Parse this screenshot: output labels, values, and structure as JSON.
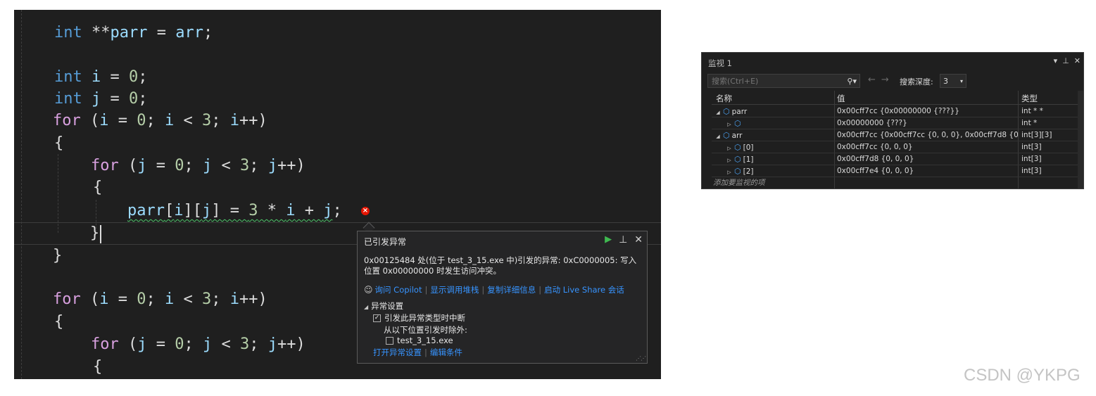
{
  "editor": {
    "lines": [
      {
        "parts": [
          [
            "kw",
            "int"
          ],
          [
            "op",
            " **"
          ],
          [
            "var",
            "parr"
          ],
          [
            "op",
            " = "
          ],
          [
            "var",
            "arr"
          ],
          [
            "op",
            ";"
          ]
        ]
      },
      {
        "parts": [
          [
            "kw",
            "int"
          ],
          [
            "op",
            " "
          ],
          [
            "var",
            "i"
          ],
          [
            "op",
            " = "
          ],
          [
            "num",
            "0"
          ],
          [
            "op",
            ";"
          ]
        ]
      },
      {
        "parts": [
          [
            "kw",
            "int"
          ],
          [
            "op",
            " "
          ],
          [
            "var",
            "j"
          ],
          [
            "op",
            " = "
          ],
          [
            "num",
            "0"
          ],
          [
            "op",
            ";"
          ]
        ]
      },
      {
        "parts": [
          [
            "kw2",
            "for"
          ],
          [
            "op",
            " ("
          ],
          [
            "var",
            "i"
          ],
          [
            "op",
            " = "
          ],
          [
            "num",
            "0"
          ],
          [
            "op",
            "; "
          ],
          [
            "var",
            "i"
          ],
          [
            "op",
            " < "
          ],
          [
            "num",
            "3"
          ],
          [
            "op",
            "; "
          ],
          [
            "var",
            "i"
          ],
          [
            "op",
            "++)"
          ]
        ]
      },
      {
        "parts": [
          [
            "op",
            "{"
          ]
        ]
      },
      {
        "parts": [
          [
            "kw2",
            "for"
          ],
          [
            "op",
            " ("
          ],
          [
            "var",
            "j"
          ],
          [
            "op",
            " = "
          ],
          [
            "num",
            "0"
          ],
          [
            "op",
            "; "
          ],
          [
            "var",
            "j"
          ],
          [
            "op",
            " < "
          ],
          [
            "num",
            "3"
          ],
          [
            "op",
            "; "
          ],
          [
            "var",
            "j"
          ],
          [
            "op",
            "++)"
          ]
        ]
      },
      {
        "parts": [
          [
            "op",
            "{"
          ]
        ]
      },
      {
        "parts": [
          [
            "var squig",
            "parr"
          ],
          [
            "op squig",
            "["
          ],
          [
            "var squig",
            "i"
          ],
          [
            "op squig",
            "]["
          ],
          [
            "var squig",
            "j"
          ],
          [
            "op squig",
            "] = "
          ],
          [
            "num squig",
            "3"
          ],
          [
            "op squig",
            " * "
          ],
          [
            "var squig",
            "i"
          ],
          [
            "op squig",
            " + "
          ],
          [
            "var squig",
            "j"
          ],
          [
            "op",
            ";"
          ]
        ]
      },
      {
        "parts": [
          [
            "op",
            "}"
          ]
        ]
      },
      {
        "parts": [
          [
            "op",
            "}"
          ]
        ]
      },
      {
        "parts": [
          [
            "kw2",
            "for"
          ],
          [
            "op",
            " ("
          ],
          [
            "var",
            "i"
          ],
          [
            "op",
            " = "
          ],
          [
            "num",
            "0"
          ],
          [
            "op",
            "; "
          ],
          [
            "var",
            "i"
          ],
          [
            "op",
            " < "
          ],
          [
            "num",
            "3"
          ],
          [
            "op",
            "; "
          ],
          [
            "var",
            "i"
          ],
          [
            "op",
            "++)"
          ]
        ]
      },
      {
        "parts": [
          [
            "op",
            "{"
          ]
        ]
      },
      {
        "parts": [
          [
            "kw2",
            "for"
          ],
          [
            "op",
            " ("
          ],
          [
            "var",
            "j"
          ],
          [
            "op",
            " = "
          ],
          [
            "num",
            "0"
          ],
          [
            "op",
            "; "
          ],
          [
            "var",
            "j"
          ],
          [
            "op",
            " < "
          ],
          [
            "num",
            "3"
          ],
          [
            "op",
            "; "
          ],
          [
            "var",
            "j"
          ],
          [
            "op",
            "++)"
          ]
        ]
      },
      {
        "parts": [
          [
            "op",
            "{"
          ]
        ]
      }
    ]
  },
  "exception": {
    "title": "已引发异常",
    "message": "0x00125484 处(位于 test_3_15.exe 中)引发的异常: 0xC0000005: 写入位置 0x00000000 时发生访问冲突。",
    "links": [
      "询问 Copilot",
      "显示调用堆栈",
      "复制详细信息",
      "启动 Live Share 会话"
    ],
    "settings_header": "异常设置",
    "break_label": "引发此异常类型时中断",
    "except_label": "从以下位置引发时除外:",
    "exe_label": "test_3_15.exe",
    "open_settings": "打开异常设置",
    "edit_conditions": "编辑条件"
  },
  "watch": {
    "title": "监视 1",
    "search_placeholder": "搜索(Ctrl+E)",
    "depth_label": "搜索深度:",
    "depth_value": "3",
    "columns": {
      "name": "名称",
      "value": "值",
      "type": "类型"
    },
    "rows": [
      {
        "indent": 0,
        "expander": "◢",
        "name": "parr",
        "value": "0x00cff7cc {0x00000000 {???}}",
        "type": "int * *"
      },
      {
        "indent": 1,
        "expander": "▷",
        "name": "",
        "value": "0x00000000 {???}",
        "type": "int *"
      },
      {
        "indent": 0,
        "expander": "◢",
        "name": "arr",
        "value": "0x00cff7cc {0x00cff7cc {0, 0, 0}, 0x00cff7d8 {0, ...",
        "type": "int[3][3]"
      },
      {
        "indent": 1,
        "expander": "▷",
        "name": "[0]",
        "value": "0x00cff7cc {0, 0, 0}",
        "type": "int[3]"
      },
      {
        "indent": 1,
        "expander": "▷",
        "name": "[1]",
        "value": "0x00cff7d8 {0, 0, 0}",
        "type": "int[3]"
      },
      {
        "indent": 1,
        "expander": "▷",
        "name": "[2]",
        "value": "0x00cff7e4 {0, 0, 0}",
        "type": "int[3]"
      }
    ],
    "add_item": "添加要监视的项"
  },
  "watermark": "CSDN @YKPG",
  "colors": {
    "keyword": "#569cd6",
    "control": "#d8a0df",
    "variable": "#9cdcfe",
    "number": "#b5cea8",
    "link": "#3794ff",
    "error": "#e51400"
  }
}
